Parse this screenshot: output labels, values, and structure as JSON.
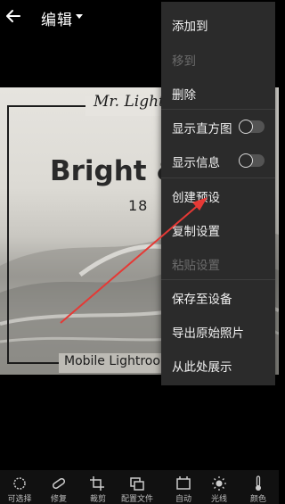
{
  "header": {
    "title": "编辑"
  },
  "photo": {
    "script_title": "Mr. Lightroom",
    "headline": "Bright &",
    "number": "18",
    "footer": "Mobile Lightroom"
  },
  "menu": {
    "items": [
      {
        "label": "添加到",
        "enabled": true
      },
      {
        "label": "移到",
        "enabled": false
      },
      {
        "label": "删除",
        "enabled": true
      },
      {
        "label": "显示直方图",
        "enabled": true,
        "toggle": false
      },
      {
        "label": "显示信息",
        "enabled": true,
        "toggle": false
      },
      {
        "label": "创建预设",
        "enabled": true
      },
      {
        "label": "复制设置",
        "enabled": true
      },
      {
        "label": "粘贴设置",
        "enabled": false
      },
      {
        "label": "保存至设备",
        "enabled": true
      },
      {
        "label": "导出原始照片",
        "enabled": true
      },
      {
        "label": "从此处展示",
        "enabled": true
      }
    ]
  },
  "toolbar": {
    "tools": [
      {
        "label": "可选择",
        "icon": "selective-icon"
      },
      {
        "label": "修复",
        "icon": "bandage-icon"
      },
      {
        "label": "裁剪",
        "icon": "crop-icon"
      },
      {
        "label": "配置文件",
        "icon": "profiles-icon"
      },
      {
        "label": "自动",
        "icon": "auto-icon"
      },
      {
        "label": "光线",
        "icon": "sun-icon"
      },
      {
        "label": "颜色",
        "icon": "thermometer-icon"
      }
    ]
  },
  "colors": {
    "annotation_arrow": "#e53935",
    "menu_bg": "#2b2b2b",
    "disabled_text": "#6c6c6c"
  }
}
